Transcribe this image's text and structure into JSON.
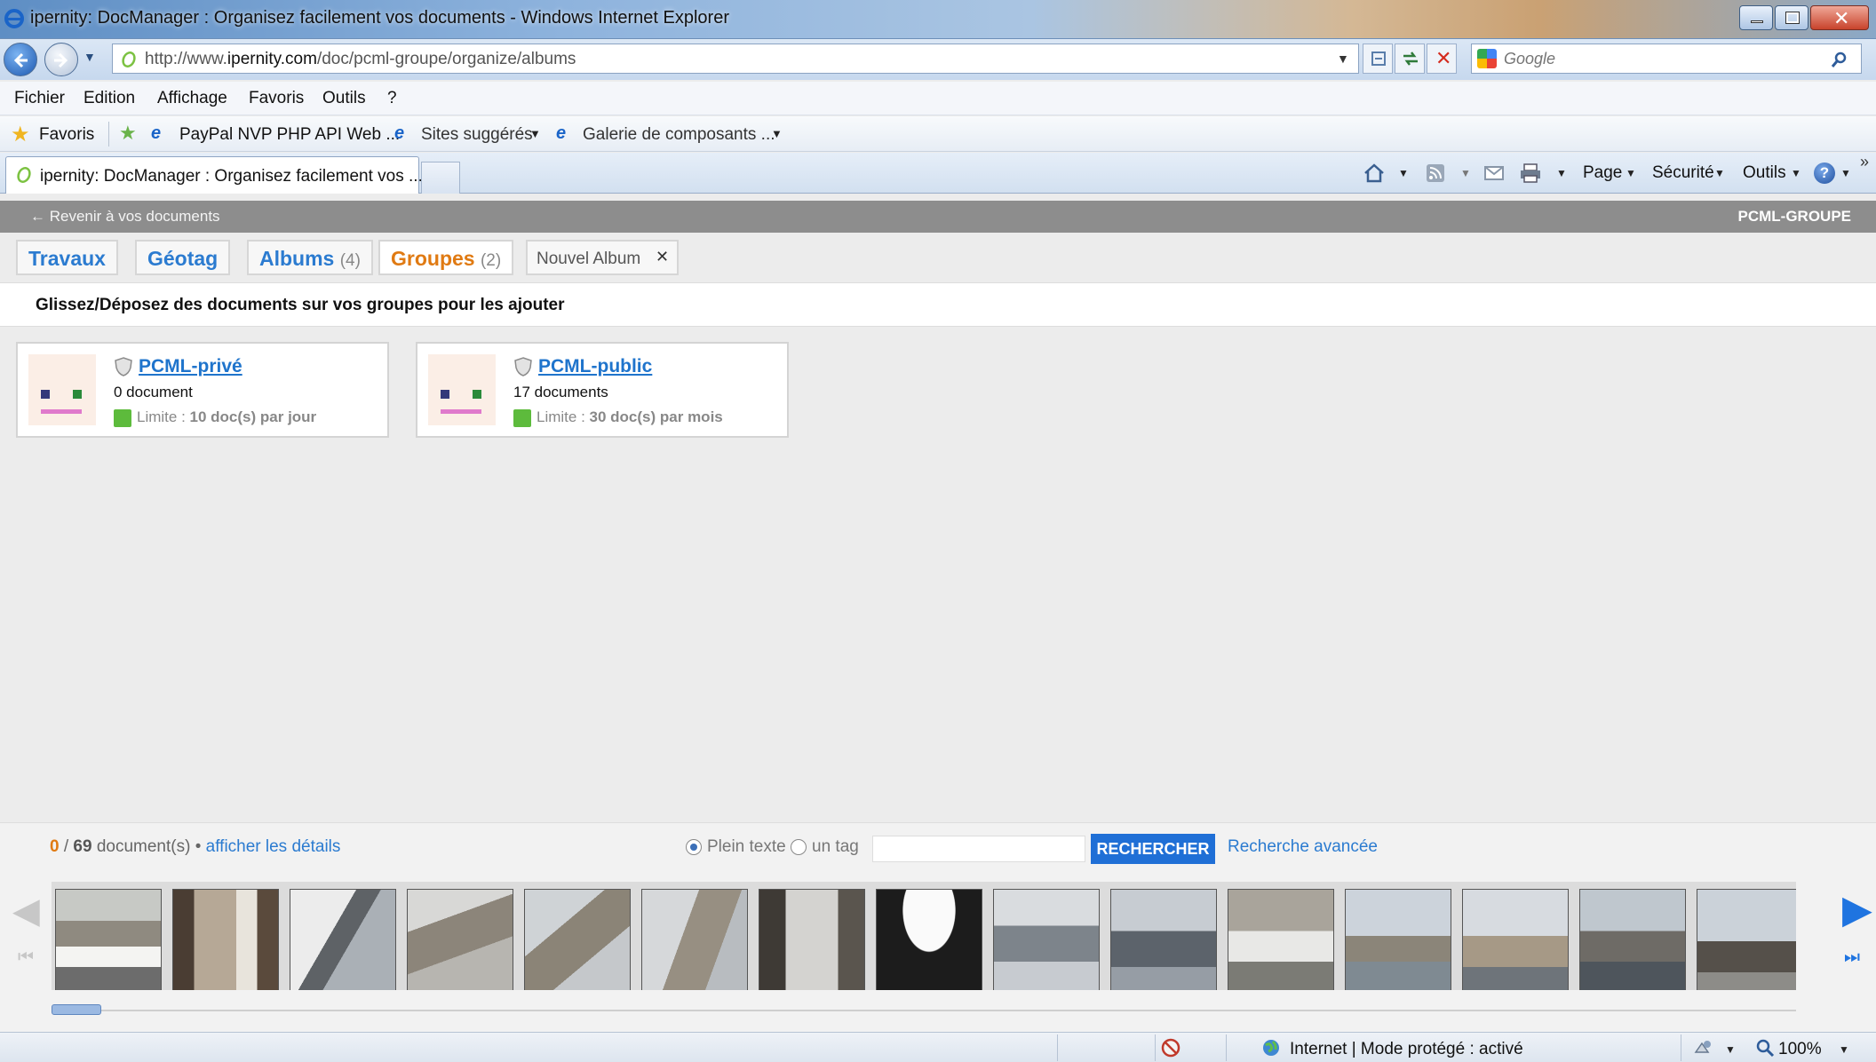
{
  "window": {
    "title": "ipernity: DocManager : Organisez facilement vos documents - Windows Internet Explorer"
  },
  "addressbar": {
    "url_prefix": "http://www.",
    "url_domain": "ipernity.com",
    "url_path": "/doc/pcml-groupe/organize/albums",
    "search_placeholder": "Google"
  },
  "menu": {
    "items": [
      "Fichier",
      "Edition",
      "Affichage",
      "Favoris",
      "Outils",
      "?"
    ]
  },
  "favorites": {
    "label": "Favoris",
    "links": [
      "PayPal NVP PHP API Web ...",
      "Sites suggérés",
      "Galerie de composants ..."
    ]
  },
  "tabs": {
    "active_label": "ipernity: DocManager : Organisez facilement vos ..."
  },
  "commandbar": {
    "page": "Page",
    "security": "Sécurité",
    "tools": "Outils"
  },
  "pageheader": {
    "back": "← Revenir à vos documents",
    "group": "PCML-GROUPE"
  },
  "contenttabs": [
    {
      "label": "Travaux",
      "count": ""
    },
    {
      "label": "Géotag",
      "count": ""
    },
    {
      "label": "Albums",
      "count": "(4)"
    },
    {
      "label": "Groupes",
      "count": "(2)"
    }
  ],
  "newalbum": "Nouvel Album",
  "instruction": "Glissez/Déposez des documents sur vos groupes pour les ajouter",
  "groups": [
    {
      "name": "PCML-privé",
      "count": "0 document",
      "limit_prefix": "Limite : ",
      "limit": "10 doc(s) par jour"
    },
    {
      "name": "PCML-public",
      "count": "17 documents",
      "limit_prefix": "Limite : ",
      "limit": "30 doc(s) par mois"
    }
  ],
  "browser": {
    "selected": "0",
    "separator": " / ",
    "total": "69",
    "suffix": " document(s) • ",
    "details_link": "afficher les détails",
    "radio_fulltext": "Plein texte",
    "radio_tag": "un tag",
    "search_button": "RECHERCHER",
    "advanced": "Recherche avancée"
  },
  "statusbar": {
    "zone": "Internet | Mode protégé : activé",
    "zoom": "100%"
  },
  "colors": {
    "link": "#2b7bd0",
    "active_tab": "#e07a12",
    "search_button": "#1f6fd6",
    "header_gray": "#8d8d8d"
  }
}
